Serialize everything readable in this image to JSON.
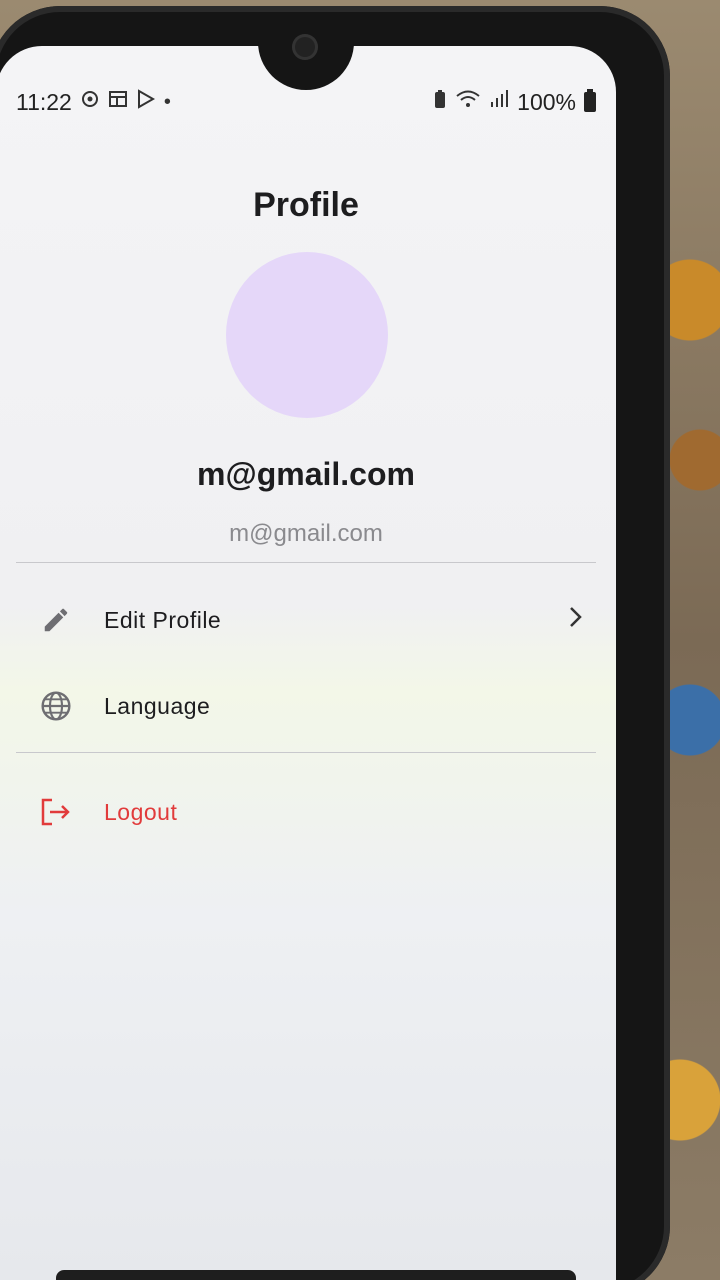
{
  "status_bar": {
    "time": "11:22",
    "battery": "100%"
  },
  "page": {
    "title": "Profile"
  },
  "profile": {
    "name": "m@gmail.com",
    "email": "m@gmail.com",
    "avatar_color": "#e5d7f9"
  },
  "menu": {
    "edit_profile": "Edit Profile",
    "language": "Language",
    "logout": "Logout"
  },
  "colors": {
    "logout": "#e13b3b"
  }
}
